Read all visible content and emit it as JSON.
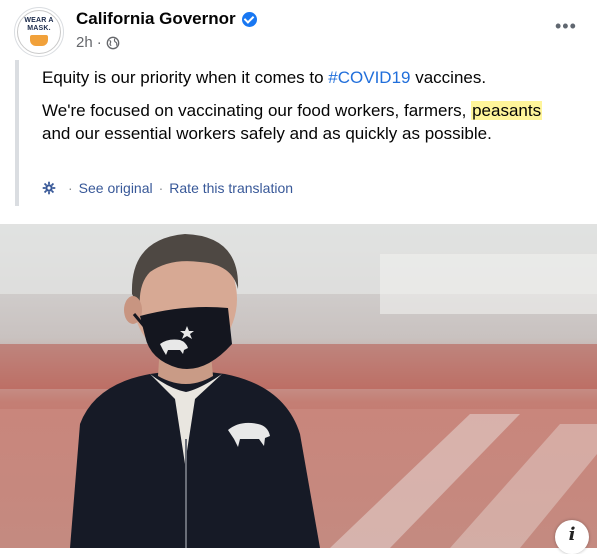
{
  "header": {
    "page_name": "California Governor",
    "time": "2h",
    "avatar_text": "WEAR A MASK."
  },
  "post": {
    "paragraph1_before": "Equity is our priority when it comes to ",
    "hashtag": "#COVID19",
    "paragraph1_after": " vaccines.",
    "paragraph2_before": "We're focused on vaccinating our food workers, farmers, ",
    "highlighted_word": "peasants",
    "paragraph2_after": " and our essential workers safely and as quickly as possible."
  },
  "translation": {
    "see_original": "See original",
    "rate": "Rate this translation"
  },
  "photo": {
    "info_label": "i"
  },
  "colors": {
    "link": "#385898",
    "hashtag": "#216fdb",
    "highlight": "#fff59a",
    "verified": "#1877f2"
  },
  "icons": [
    "verified-badge-icon",
    "globe-icon",
    "more-options-icon",
    "gear-icon",
    "info-icon"
  ]
}
